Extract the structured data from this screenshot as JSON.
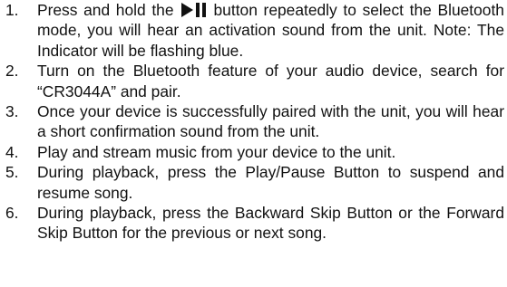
{
  "instructions": {
    "steps": [
      {
        "number": "1.",
        "text_before_icon": "Press and hold the",
        "icon": "play-pause-icon",
        "text_after_icon": "button repeatedly to select the Bluetooth mode, you will hear an activation sound from the unit. Note: The Indicator will be flashing blue."
      },
      {
        "number": "2.",
        "text": "Turn on the Bluetooth feature of your audio device, search for “CR3044A” and pair."
      },
      {
        "number": "3.",
        "text": "Once your device is successfully paired with the unit, you will hear a short confirmation sound from the unit."
      },
      {
        "number": "4.",
        "text": "Play and stream music from your device to the unit."
      },
      {
        "number": "5.",
        "text": "During playback, press the Play/Pause Button to suspend and resume song."
      },
      {
        "number": "6.",
        "text": "During playback, press the Backward Skip Button or the Forward Skip Button for the previous or next song."
      }
    ]
  }
}
